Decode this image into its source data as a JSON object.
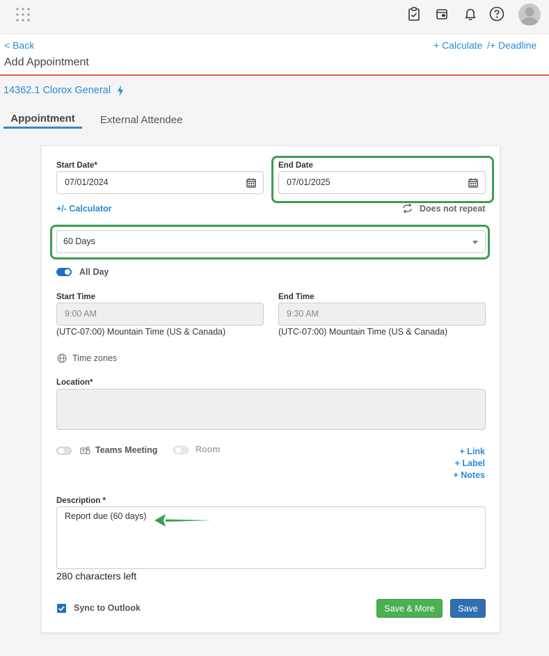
{
  "topbar": {
    "icons": [
      "apps-grid-icon",
      "clipboard-check-icon",
      "calendar-wallet-icon",
      "bell-icon",
      "help-circle-icon",
      "user-avatar-icon"
    ]
  },
  "header": {
    "back": "< Back",
    "title": "Add Appointment",
    "calculate": "+ Calculate",
    "deadline": "/+ Deadline"
  },
  "matter": {
    "label": "14362.1 Clorox General"
  },
  "tabs": [
    {
      "label": "Appointment",
      "active": true
    },
    {
      "label": "External Attendee",
      "active": false
    }
  ],
  "form": {
    "start_date_label": "Start Date*",
    "start_date_value": "07/01/2024",
    "end_date_label": "End Date",
    "end_date_value": "07/01/2025",
    "calculator": "+/- Calculator",
    "repeat": "Does not repeat",
    "duration_value": "60 Days",
    "all_day_label": "All Day",
    "all_day_on": true,
    "start_time_label": "Start Time",
    "start_time_value": "9:00 AM",
    "start_tz": "(UTC-07:00) Mountain Time (US & Canada)",
    "end_time_label": "End Time",
    "end_time_value": "9:30 AM",
    "end_tz": "(UTC-07:00) Mountain Time (US & Canada)",
    "time_zones": "Time zones",
    "location_label": "Location*",
    "location_value": "",
    "teams_label": "Teams Meeting",
    "room_label": "Room",
    "link": "+ Link",
    "label": "+ Label",
    "notes": "+ Notes",
    "description_label": "Description *",
    "description_value": "Report due (60 days)",
    "chars_left": "280 characters left",
    "sync_label": "Sync to Outlook",
    "sync_checked": true,
    "save_more": "Save & More",
    "save": "Save"
  },
  "colors": {
    "accent_link": "#2a8bd6",
    "header_rule": "#e05a47",
    "highlight": "#3c9d50",
    "save_more_btn": "#4caf50",
    "save_btn": "#2f6fb0",
    "toggle_on": "#1f6fc4"
  }
}
